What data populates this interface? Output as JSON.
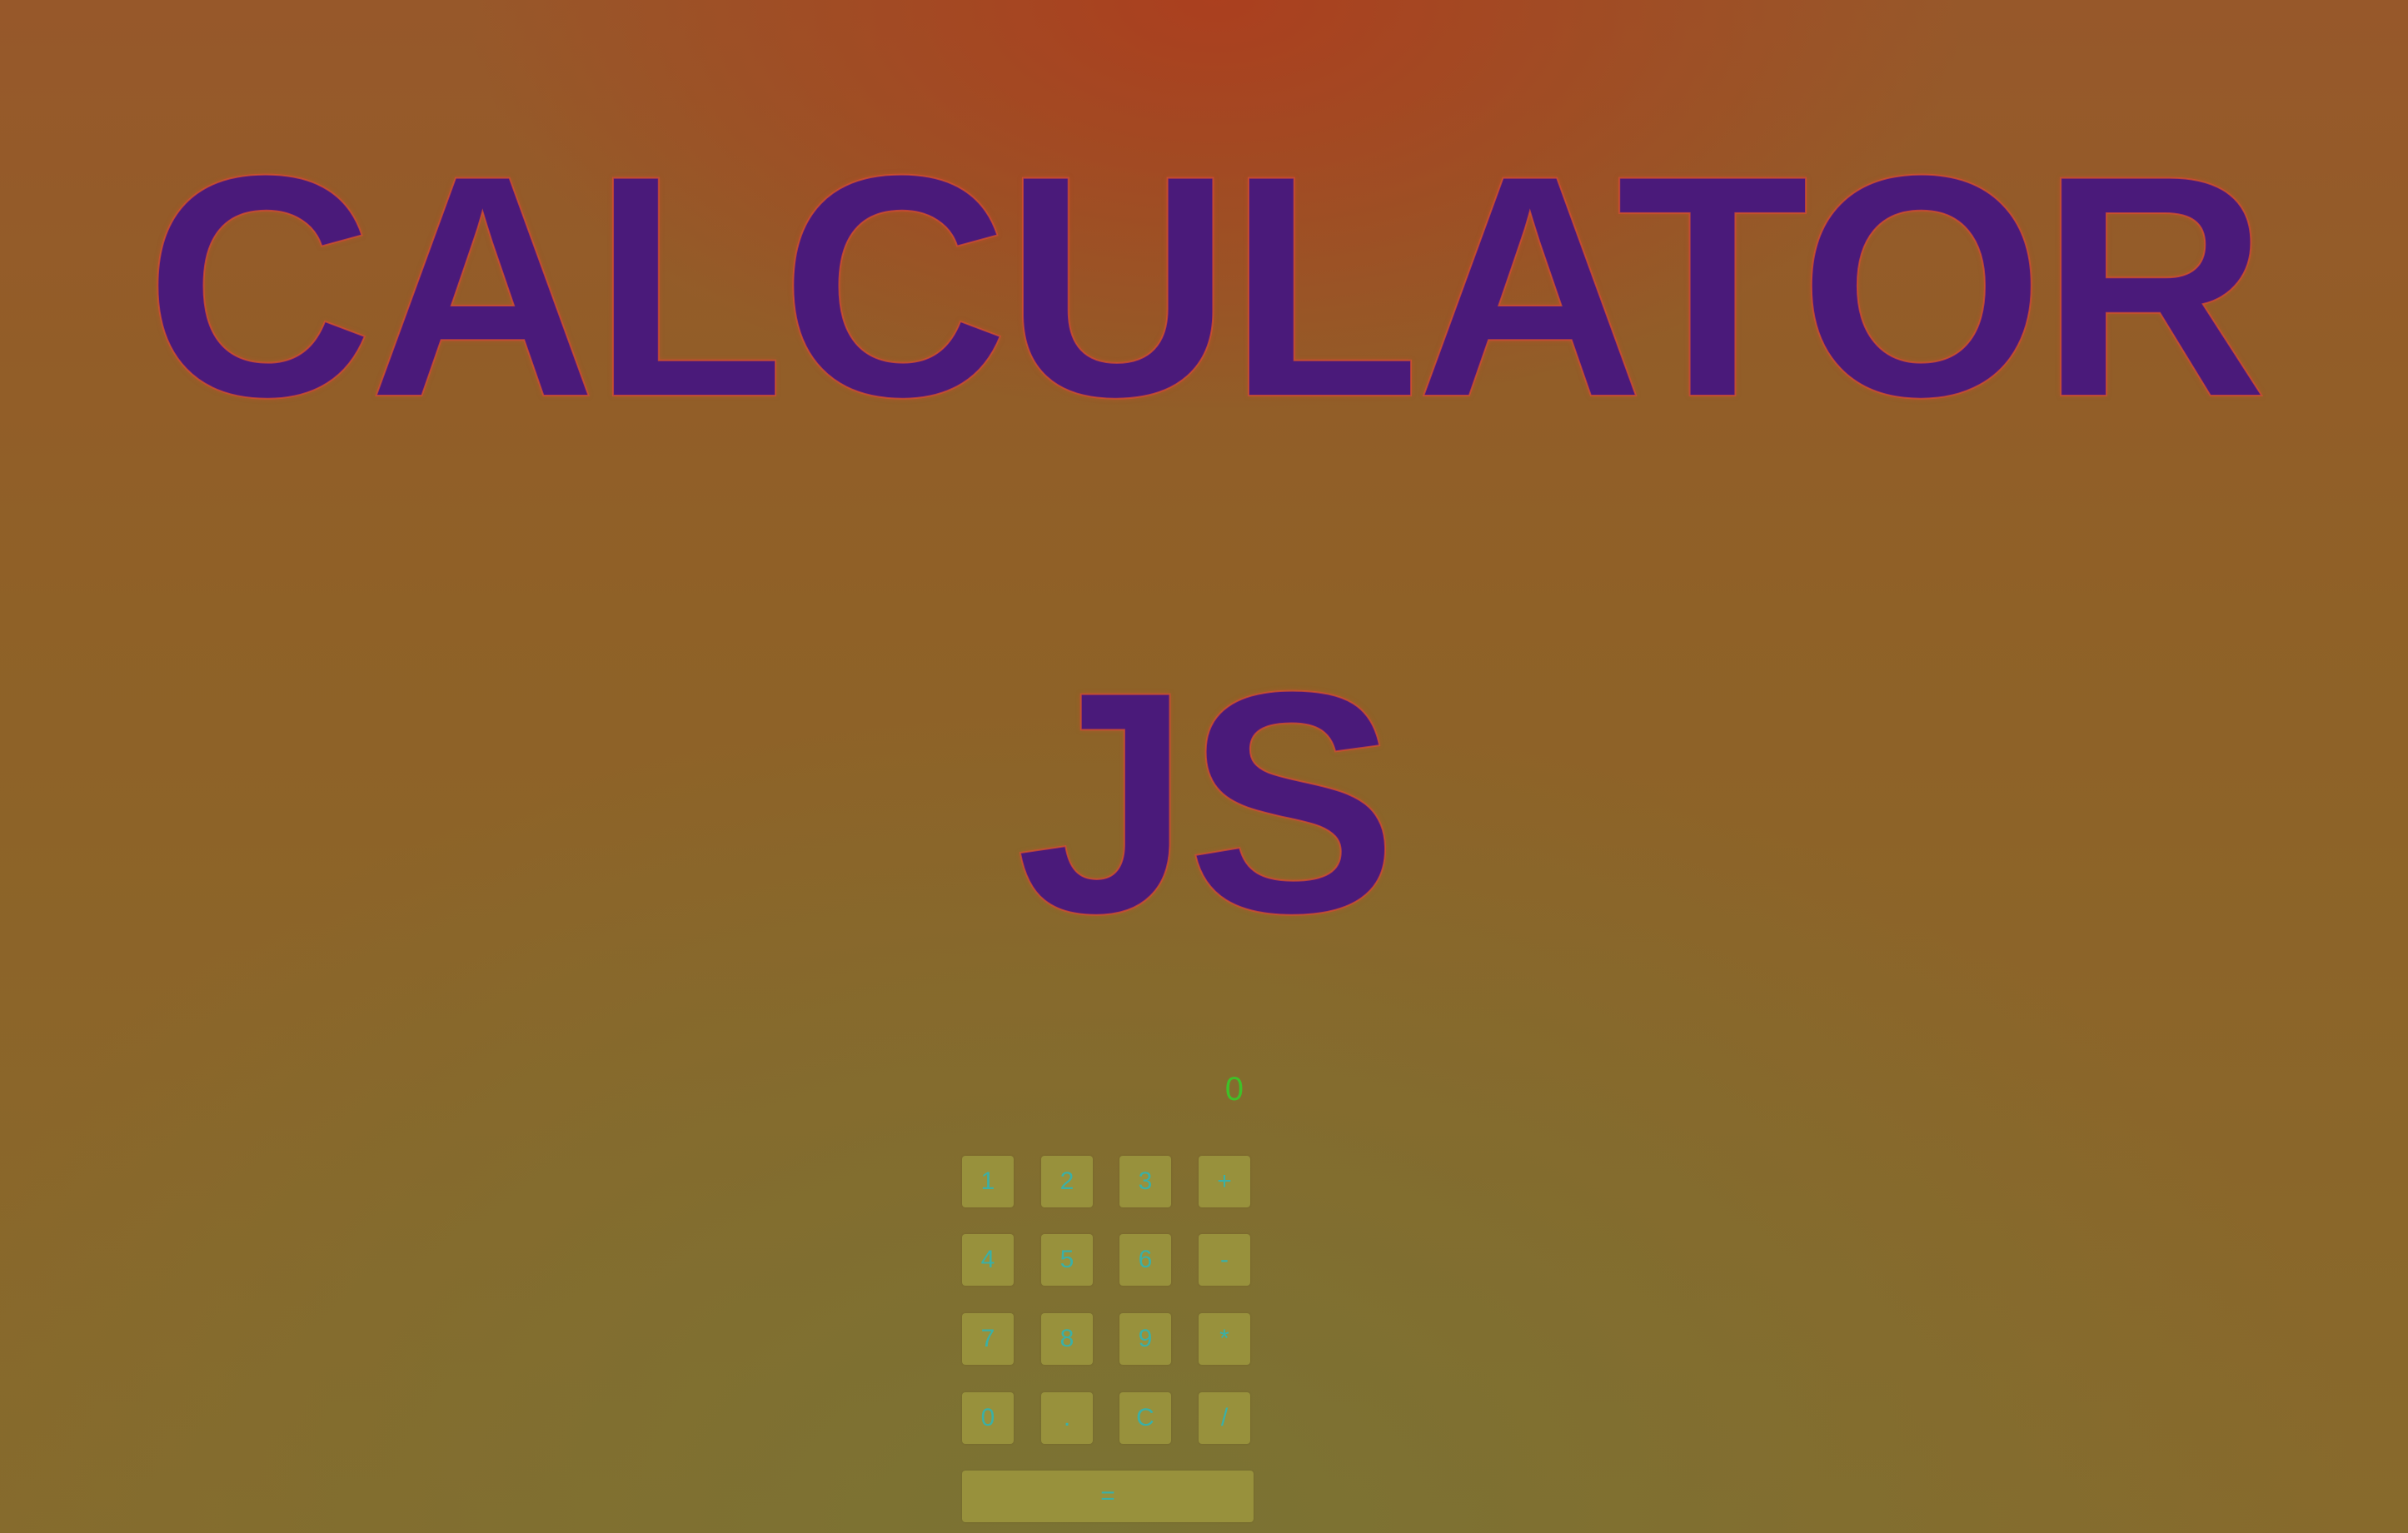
{
  "title": {
    "line1": "CALCULATOR",
    "line2": "JS"
  },
  "calculator": {
    "display": "0",
    "keys": [
      {
        "label": "1"
      },
      {
        "label": "2"
      },
      {
        "label": "3"
      },
      {
        "label": "+"
      },
      {
        "label": "4"
      },
      {
        "label": "5"
      },
      {
        "label": "6"
      },
      {
        "label": "-"
      },
      {
        "label": "7"
      },
      {
        "label": "8"
      },
      {
        "label": "9"
      },
      {
        "label": "*"
      },
      {
        "label": "0"
      },
      {
        "label": "."
      },
      {
        "label": "C"
      },
      {
        "label": "/"
      }
    ],
    "equals": "="
  },
  "colors": {
    "title": "#4a1a7a",
    "title_outline": "#d64e30",
    "display_text": "#3fc028",
    "key_background": "#98913c",
    "key_text": "#3ab0a6"
  }
}
